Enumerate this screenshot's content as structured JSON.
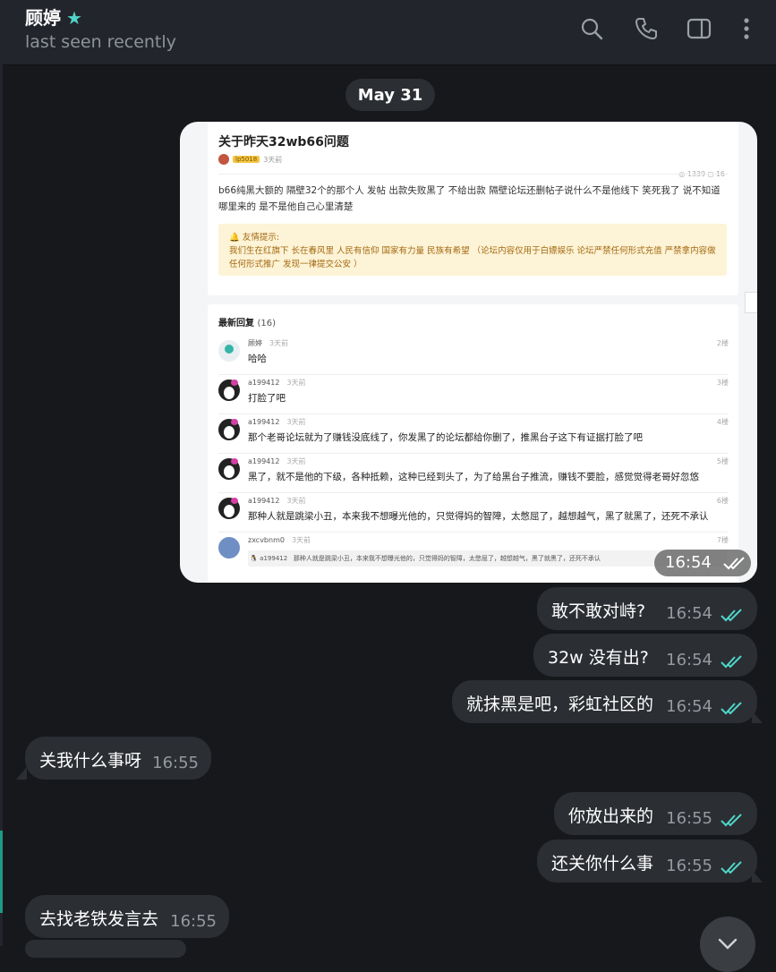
{
  "header": {
    "chat_name": "顾婷",
    "status": "last seen recently",
    "icons": [
      "search-icon",
      "phone-icon",
      "sidebar-toggle-icon",
      "more-vert-icon"
    ]
  },
  "date_separator": "May 31",
  "image_message": {
    "time": "16:54",
    "screenshot": {
      "title": "关于昨天32wb66问题",
      "author_tag": "lp5018",
      "author_ago": "3天前",
      "stats": "◎ 1339  ◻ 16",
      "body": "b66纯黑大额的 隔壁32个的那个人 发帖 出款失败黑了 不给出款 隔壁论坛还删帖子说什么不是他线下 笑死我了 说不知道哪里来的 是不是他自己心里清楚",
      "notice_title": "友情提示:",
      "notice_body": "我们生在红旗下 长在春风里 人民有信仰 国家有力量 民族有希望 （论坛内容仅用于白嫖娱乐 论坛严禁任何形式充值 严禁拿内容做任何形式推广 发现一律提交公安 ）",
      "replies_label": "最新回复",
      "replies_count": "(16)",
      "replies": [
        {
          "user": "顾婷",
          "ago": "3天前",
          "floor": "2楼",
          "content": "哈哈"
        },
        {
          "user": "a199412",
          "ago": "3天前",
          "floor": "3楼",
          "content": "打脸了吧"
        },
        {
          "user": "a199412",
          "ago": "3天前",
          "floor": "4楼",
          "content": "那个老哥论坛就为了赚钱没底线了，你发黑了的论坛都给你删了，推黑台子这下有证据打脸了吧"
        },
        {
          "user": "a199412",
          "ago": "3天前",
          "floor": "5楼",
          "content": "黑了，就不是他的下级，各种抵赖，这种已经到头了，为了给黑台子推流，赚钱不要脸，感觉觉得老哥好忽悠"
        },
        {
          "user": "a199412",
          "ago": "3天前",
          "floor": "6楼",
          "content": "那种人就是跳梁小丑，本来我不想曝光他的，只觉得妈的智障，太憋屈了，越想越气，黑了就黑了，还死不承认"
        },
        {
          "user": "zxcvbnm0",
          "ago": "3天前",
          "floor": "7楼",
          "quote_user": "a199412",
          "quote": "那种人就是跳梁小丑，本来我不想曝光他的，只觉得妈的智障，太憋屈了，越想越气，黑了就黑了，还死不承认"
        }
      ]
    }
  },
  "messages": [
    {
      "text": "敢不敢对峙?",
      "time": "16:54"
    },
    {
      "text": "32w 没有出?",
      "time": "16:54"
    },
    {
      "text": "就抹黑是吧，彩虹社区的",
      "time": "16:54"
    },
    {
      "text": "关我什么事呀",
      "time": "16:55"
    },
    {
      "text": "你放出来的",
      "time": "16:55"
    },
    {
      "text": "还关你什么事",
      "time": "16:55"
    },
    {
      "text": "去找老铁发言去",
      "time": "16:55"
    }
  ],
  "colors": {
    "background": "#17181c",
    "header": "#22252b",
    "bubble": "#2b2e33",
    "read_check": "#4fd6c8",
    "accent": "#1e9a86"
  }
}
